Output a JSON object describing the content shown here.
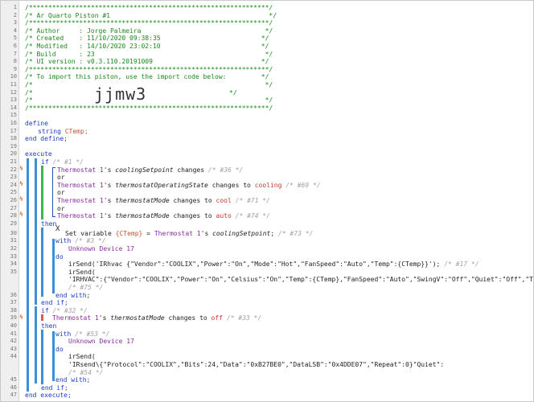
{
  "line_numbers": [
    "1",
    "2",
    "3",
    "4",
    "5",
    "6",
    "7",
    "8",
    "9",
    "10",
    "11",
    "12",
    "13",
    "14",
    "15",
    "16",
    "17",
    "18",
    "19",
    "20",
    "21",
    "22",
    "23",
    "24",
    "25",
    "26",
    "27",
    "28",
    "29",
    "30",
    "31",
    "32",
    "33",
    "34",
    "35",
    "",
    "36",
    "37",
    "38",
    "39",
    "40",
    "41",
    "42",
    "43",
    "44",
    "",
    "45",
    "46",
    "47"
  ],
  "header": {
    "border": "/**************************************************************/",
    "title": "/* Ar Quarto Piston #1                                         */",
    "author": "/* Author     : Jorge Palmeira                                */",
    "created": "/* Created    : 11/10/2020 09:38:35                          */",
    "modified": "/* Modified   : 14/10/2020 23:02:10                          */",
    "build": "/* Build      : 23                                            */",
    "ui_version": "/* UI version : v0.3.110.20191009                            */",
    "import_line": "/* To import this piston, use the import code below:         */",
    "blank1": "/*                                                            */",
    "import_prefix": "/*",
    "import_suffix": "*/",
    "blank2": "/*                                                            */",
    "import_code": "jjmw3"
  },
  "code": {
    "define": "define",
    "string_kw": "string",
    "ctemp": "CTemp;",
    "end_define": "end define;",
    "execute": "execute",
    "if1": "if",
    "if1_note": "/* #1 */",
    "thermostat": "Thermostat 1",
    "apos_s": "'s",
    "cooling_setpoint": "coolingSetpoint",
    "changes": "changes",
    "note_36": "/* #36 */",
    "or": "or",
    "op_state": "thermostatOperatingState",
    "changes_to": "changes to",
    "cooling": "cooling",
    "note_69": "/* #69 */",
    "mode": "thermostatMode",
    "cool": "cool",
    "note_71": "/* #71 */",
    "auto": "auto",
    "note_74": "/* #74 */",
    "then": "then",
    "xv_icon": "X",
    "set_variable": "Set variable",
    "ctemp_var": "{CTemp}",
    "equals": "=",
    "note_73": "/* #73 */",
    "with": "with",
    "note_3": "/* #3 */",
    "unknown_device": "Unknown Device 17",
    "do": "do",
    "irsend": "irSend(",
    "irsend1": "irSend('IRhvac {\"Vendor\":\"COOLIX\",\"Power\":\"On\",\"Mode\":\"Hot\",\"FanSpeed\":\"Auto\",\"Temp\":{CTemp}}');",
    "note_17": "/* #17 */",
    "irsend2_cont": "'IRHVAC\":{\"Vendor\":\"COOLIX\",\"Power\":\"On\",\"Celsius\":\"On\",\"Temp\":{CTemp},\"FanSpeed\":\"Auto\",\"SwingV\":\"Off\",\"Quiet\":\"Off\",\"Turbo\":\"Off\",\"Econo",
    "note_75": "/* #75 */",
    "end_with": "end with;",
    "end_if": "end if;",
    "if2_note": "/* #32 */",
    "changes_to_off": "changes to",
    "off": "off",
    "note_33": "/* #33 */",
    "note_53": "/* #53 */",
    "irsend3_cont": "'IRsend\\{\"Protocol\":\"COOLIX\",\"Bits\":24,\"Data\":\"0xB27BE0\",\"DataLSB\":\"0x4DDE07\",\"Repeat\":0}\"Quiet\":",
    "note_54": "/* #54 */",
    "end_execute": "end execute;"
  },
  "colors": {
    "comment": "#1a8a1a",
    "keyword": "#1c3dbf",
    "device": "#8a2ba1",
    "value": "#c0392b",
    "trigger": "#e8712d",
    "bar_green": "#3cb84a",
    "bar_blue": "#3a8fd9",
    "bar_red": "#e05a4a"
  }
}
